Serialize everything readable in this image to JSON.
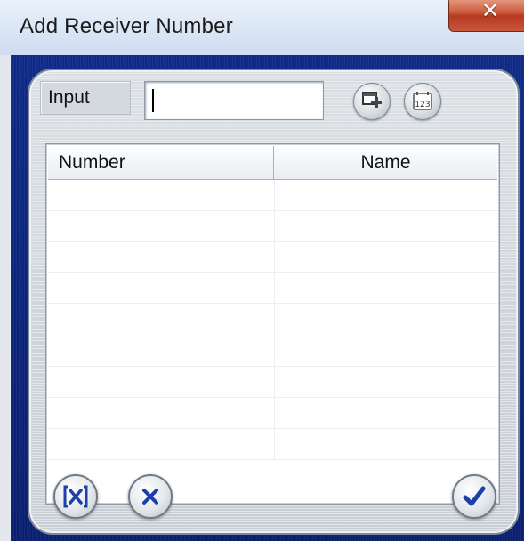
{
  "window": {
    "title": "Add Receiver Number",
    "close_icon": "close-icon"
  },
  "input": {
    "label": "Input",
    "value": "",
    "add_icon": "add-contact-icon",
    "calendar_icon": "calendar-123-icon"
  },
  "table": {
    "columns": [
      "Number",
      "Name"
    ],
    "rows": [
      [
        "",
        ""
      ],
      [
        "",
        ""
      ],
      [
        "",
        ""
      ],
      [
        "",
        ""
      ],
      [
        "",
        ""
      ],
      [
        "",
        ""
      ],
      [
        "",
        ""
      ],
      [
        "",
        ""
      ],
      [
        "",
        ""
      ]
    ]
  },
  "footer": {
    "clear_icon": "clear-box-icon",
    "cancel_icon": "cancel-x-icon",
    "confirm_icon": "checkmark-icon"
  },
  "colors": {
    "frame_blue": "#0f2a86",
    "panel_gray": "#d9dee3",
    "icon_blue": "#1e3ea8",
    "close_red": "#cc5a3c"
  }
}
